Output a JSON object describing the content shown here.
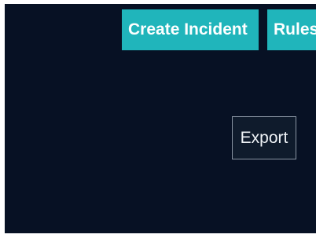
{
  "toolbar": {
    "create_incident_label": "Create Incident",
    "rules_label": "Rules"
  },
  "actions": {
    "export_label": "Export"
  },
  "colors": {
    "background": "#071124",
    "accent": "#20b5bb",
    "export_border": "#8a95a3"
  }
}
